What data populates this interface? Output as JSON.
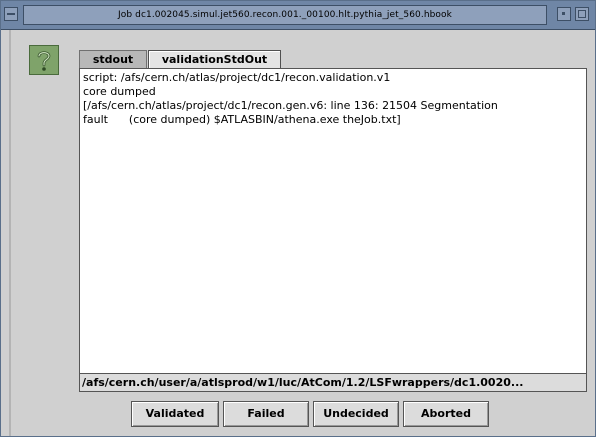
{
  "window": {
    "title": "Job dc1.002045.simul.jet560.recon.001._00100.hlt.pythia_jet_560.hbook"
  },
  "icons": {
    "menu": "window-menu-icon",
    "minimize": "minimize-icon",
    "maximize": "maximize-icon",
    "help": "question-mark-icon"
  },
  "colors": {
    "titlebar": "#6f86a6",
    "help_icon_bg": "#7fa36a"
  },
  "tabs": [
    {
      "label": "stdout"
    },
    {
      "label": "validationStdOut"
    }
  ],
  "output": {
    "lines": [
      "script: /afs/cern.ch/atlas/project/dc1/recon.validation.v1",
      "core dumped",
      "[/afs/cern.ch/atlas/project/dc1/recon.gen.v6: line 136: 21504 Segmentation",
      "fault      (core dumped) $ATLASBIN/athena.exe theJob.txt]"
    ]
  },
  "path": "/afs/cern.ch/user/a/atlsprod/w1/luc/AtCom/1.2/LSFwrappers/dc1.0020...",
  "buttons": {
    "validated": "Validated",
    "failed": "Failed",
    "undecided": "Undecided",
    "aborted": "Aborted"
  }
}
